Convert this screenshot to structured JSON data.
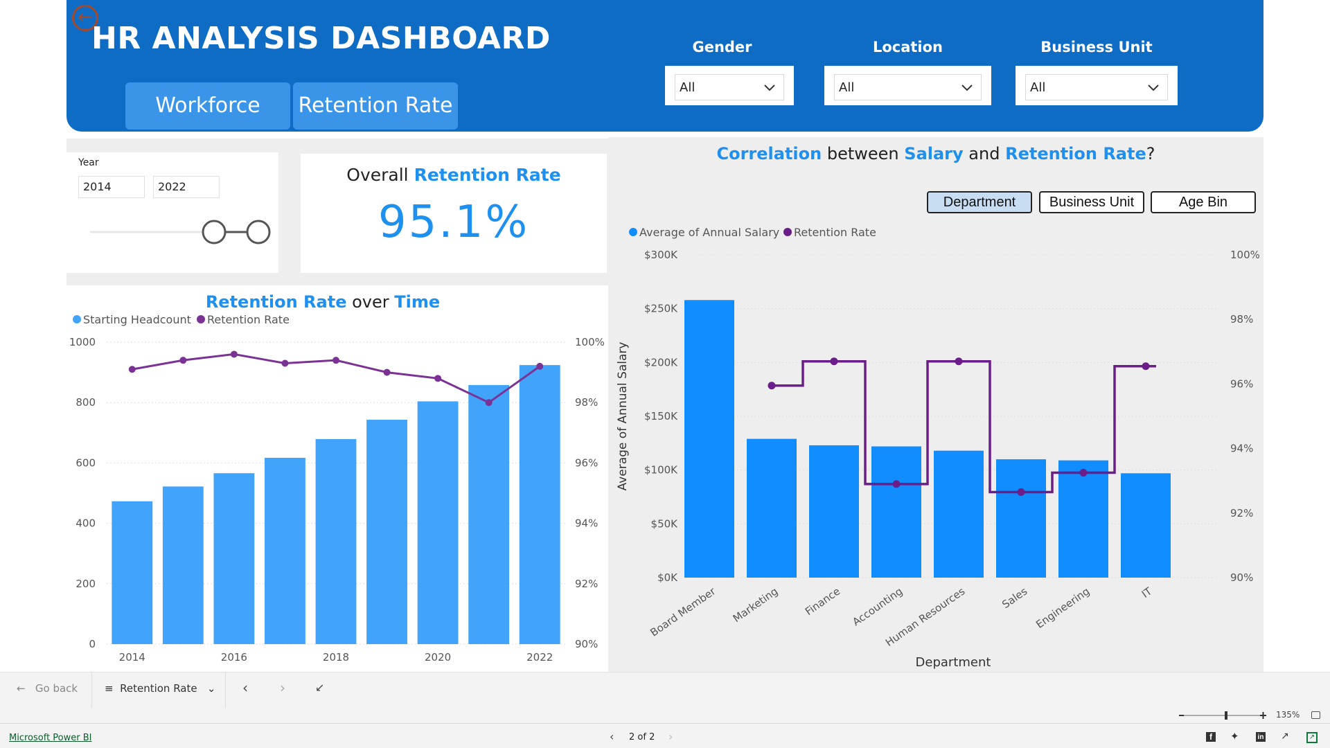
{
  "header": {
    "title": "HR ANALYSIS DASHBOARD",
    "tabs": [
      "Workforce",
      "Retention Rate"
    ],
    "filters": [
      {
        "label": "Gender",
        "value": "All"
      },
      {
        "label": "Location",
        "value": "All"
      },
      {
        "label": "Business Unit",
        "value": "All"
      }
    ]
  },
  "year_slicer": {
    "label": "Year",
    "from": "2014",
    "to": "2022"
  },
  "kpi": {
    "prefix": "Overall ",
    "highlight": "Retention Rate",
    "value": "95.1%"
  },
  "time_chart": {
    "title_a": "Retention Rate",
    "title_b": " over ",
    "title_c": "Time",
    "legend": [
      "Starting Headcount",
      "Retention Rate"
    ]
  },
  "salary_chart": {
    "title_parts": [
      "Correlation",
      " between ",
      "Salary",
      " and ",
      "Retention Rate",
      "?"
    ],
    "toggles": [
      "Department",
      "Business Unit",
      "Age Bin"
    ],
    "legend": [
      "Average of Annual Salary",
      "Retention Rate"
    ]
  },
  "chart_data": [
    {
      "type": "bar",
      "title": "Retention Rate over Time",
      "categories": [
        2014,
        2015,
        2016,
        2017,
        2018,
        2019,
        2020,
        2021,
        2022
      ],
      "x_tick_labels": [
        "2014",
        "2016",
        "2018",
        "2020",
        "2022"
      ],
      "series": [
        {
          "name": "Starting Headcount",
          "kind": "bar",
          "axis": "left",
          "values": [
            473,
            522,
            566,
            617,
            679,
            743,
            804,
            858,
            924
          ]
        },
        {
          "name": "Retention Rate",
          "kind": "line",
          "axis": "right",
          "values": [
            99.1,
            99.4,
            99.6,
            99.3,
            99.4,
            99.0,
            98.8,
            98.0,
            99.2
          ]
        }
      ],
      "ylim_left": [
        0,
        1000
      ],
      "yticks_left": [
        0,
        200,
        400,
        600,
        800,
        1000
      ],
      "ylim_right": [
        90,
        100
      ],
      "yticks_right": [
        "90%",
        "92%",
        "94%",
        "96%",
        "98%",
        "100%"
      ],
      "grid": true,
      "legend_position": "top-left",
      "colors": {
        "bar": "#41a3f9",
        "line": "#7b3294"
      }
    },
    {
      "type": "bar",
      "title": "Correlation between Salary and Retention Rate?",
      "xlabel": "Department",
      "ylabel": "Average of Annual Salary",
      "categories": [
        "Board Member",
        "Marketing",
        "Finance",
        "Accounting",
        "Human Resources",
        "Sales",
        "Engineering",
        "IT"
      ],
      "series": [
        {
          "name": "Average of Annual Salary",
          "kind": "bar",
          "axis": "left",
          "values": [
            258000,
            129000,
            123000,
            122000,
            118000,
            110000,
            109000,
            97000
          ]
        },
        {
          "name": "Retention Rate",
          "kind": "step-line",
          "axis": "right",
          "values": [
            null,
            95.95,
            96.7,
            92.9,
            96.7,
            92.65,
            93.25,
            96.55
          ]
        }
      ],
      "ylim_left": [
        0,
        300000
      ],
      "yticks_left": [
        "$0K",
        "$50K",
        "$100K",
        "$150K",
        "$200K",
        "$250K",
        "$300K"
      ],
      "ylim_right": [
        90,
        100
      ],
      "yticks_right": [
        "90%",
        "92%",
        "94%",
        "96%",
        "98%",
        "100%"
      ],
      "grid": true,
      "legend_position": "top-left",
      "colors": {
        "bar": "#118dff",
        "line": "#6b1d8a"
      }
    }
  ],
  "bottom_bar": {
    "go_back": "Go back",
    "page_name": "Retention Rate"
  },
  "zoom": {
    "level": "135%"
  },
  "footer": {
    "brand": "Microsoft Power BI",
    "page_indicator": "2 of 2"
  }
}
